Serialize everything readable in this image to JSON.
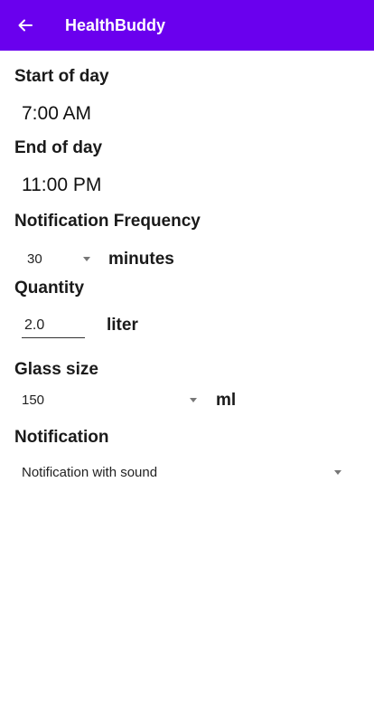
{
  "app_bar": {
    "title": "HealthBuddy",
    "back_icon": "arrow-left-icon",
    "color": "#6a00ee"
  },
  "start_of_day": {
    "label": "Start of day",
    "value": "7:00 AM"
  },
  "end_of_day": {
    "label": "End of day",
    "value": "11:00 PM"
  },
  "notification_frequency": {
    "label": "Notification Frequency",
    "value": "30",
    "unit": "minutes",
    "icon": "dropdown-caret-icon"
  },
  "quantity": {
    "label": "Quantity",
    "value": "2.0",
    "unit": "liter"
  },
  "glass_size": {
    "label": "Glass size",
    "value": "150",
    "unit": "ml",
    "icon": "dropdown-caret-icon"
  },
  "notification": {
    "label": "Notification",
    "value": "Notification with sound",
    "icon": "dropdown-caret-icon"
  }
}
